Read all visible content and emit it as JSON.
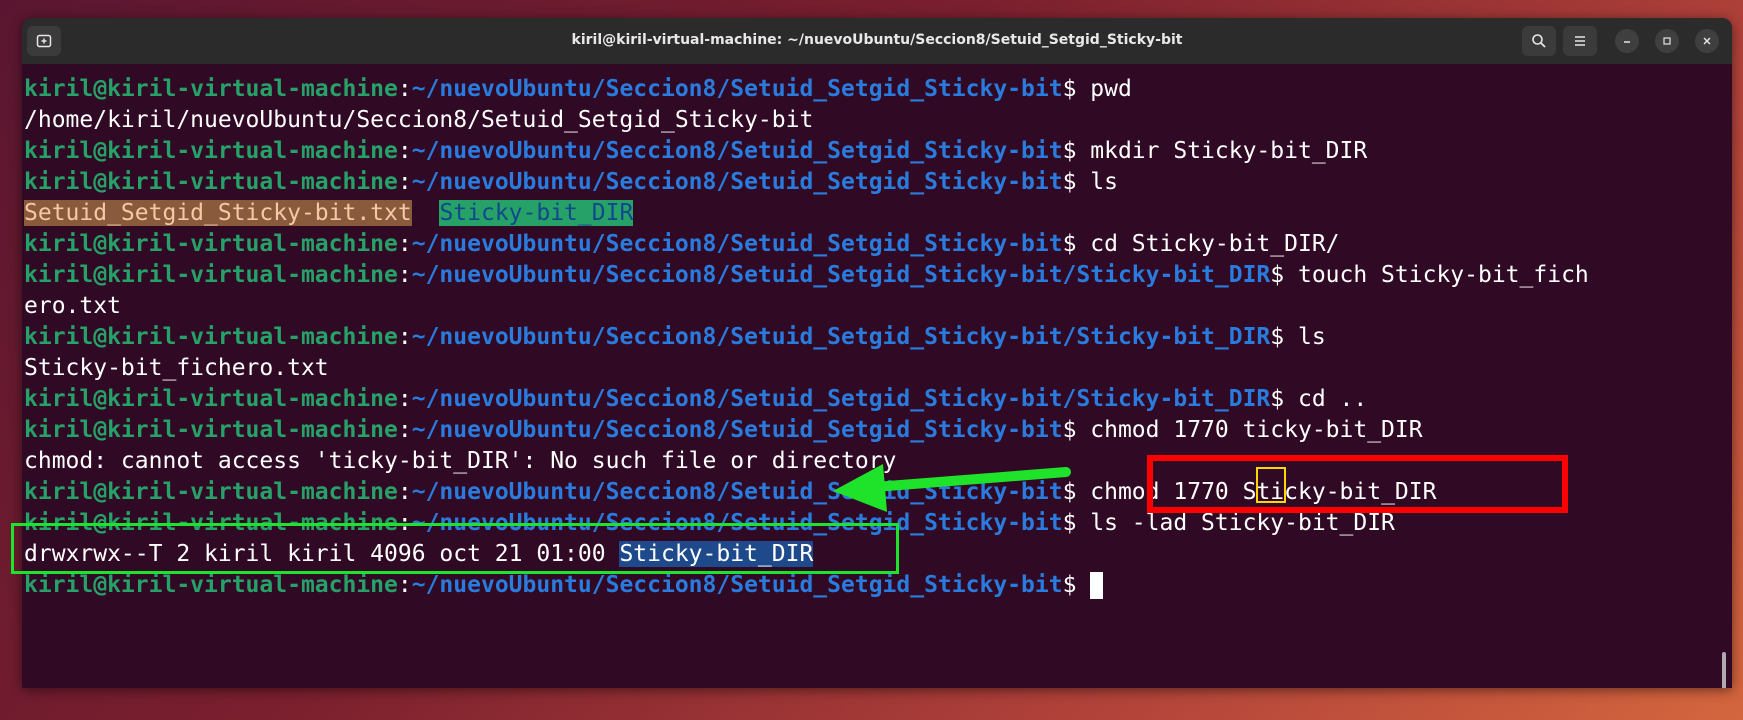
{
  "window": {
    "title": "kiril@kiril-virtual-machine: ~/nuevoUbuntu/Seccion8/Setuid_Setgid_Sticky-bit",
    "icons": [
      "new-tab-icon",
      "search-icon",
      "hamburger-menu-icon",
      "minimize-icon",
      "maximize-icon",
      "close-icon"
    ]
  },
  "prompt": {
    "user": "kiril@kiril-virtual-machine",
    "colon": ":",
    "path_base": "~/nuevoUbuntu/Seccion8/Setuid_Setgid_Sticky-bit",
    "path_sub": "~/nuevoUbuntu/Seccion8/Setuid_Setgid_Sticky-bit/Sticky-bit_DIR",
    "dollar": "$"
  },
  "terminal": {
    "cmd_pwd": " pwd",
    "out_pwd": "/home/kiril/nuevoUbuntu/Seccion8/Setuid_Setgid_Sticky-bit",
    "cmd_mkdir": " mkdir Sticky-bit_DIR",
    "cmd_ls": " ls",
    "out_ls_file": "Setuid_Setgid_Sticky-bit.txt",
    "out_ls_gap": "  ",
    "out_ls_dir": "Sticky-bit_DIR",
    "cmd_cd": " cd Sticky-bit_DIR/",
    "cmd_touch": " touch Sticky-bit_fich",
    "cmd_touch_wrap": "ero.txt",
    "cmd_ls2": " ls",
    "out_ls2": "Sticky-bit_fichero.txt",
    "cmd_cd_up": " cd ..",
    "cmd_chmod_bad": " chmod 1770 ticky-bit_DIR",
    "out_chmod_err": "chmod: cannot access 'ticky-bit_DIR': No such file or directory",
    "cmd_chmod_ok_a": " chmod ",
    "cmd_chmod_ok_b": "1",
    "cmd_chmod_ok_c": "770 Sticky-bit_DIR",
    "cmd_ls_lad": " ls -lad Sticky-bit_DIR",
    "out_lad_perm": "drwxrwx--T 2 kiril kiril 4096 oct 21 01:00 ",
    "out_lad_name": "Sticky-bit_DIR"
  },
  "colors": {
    "background": "#300a24",
    "user": "#26a269",
    "path": "#2a7bde",
    "annotation_red": "#ff0000",
    "annotation_yellow": "#ffd500",
    "annotation_green": "#1fe22a"
  }
}
